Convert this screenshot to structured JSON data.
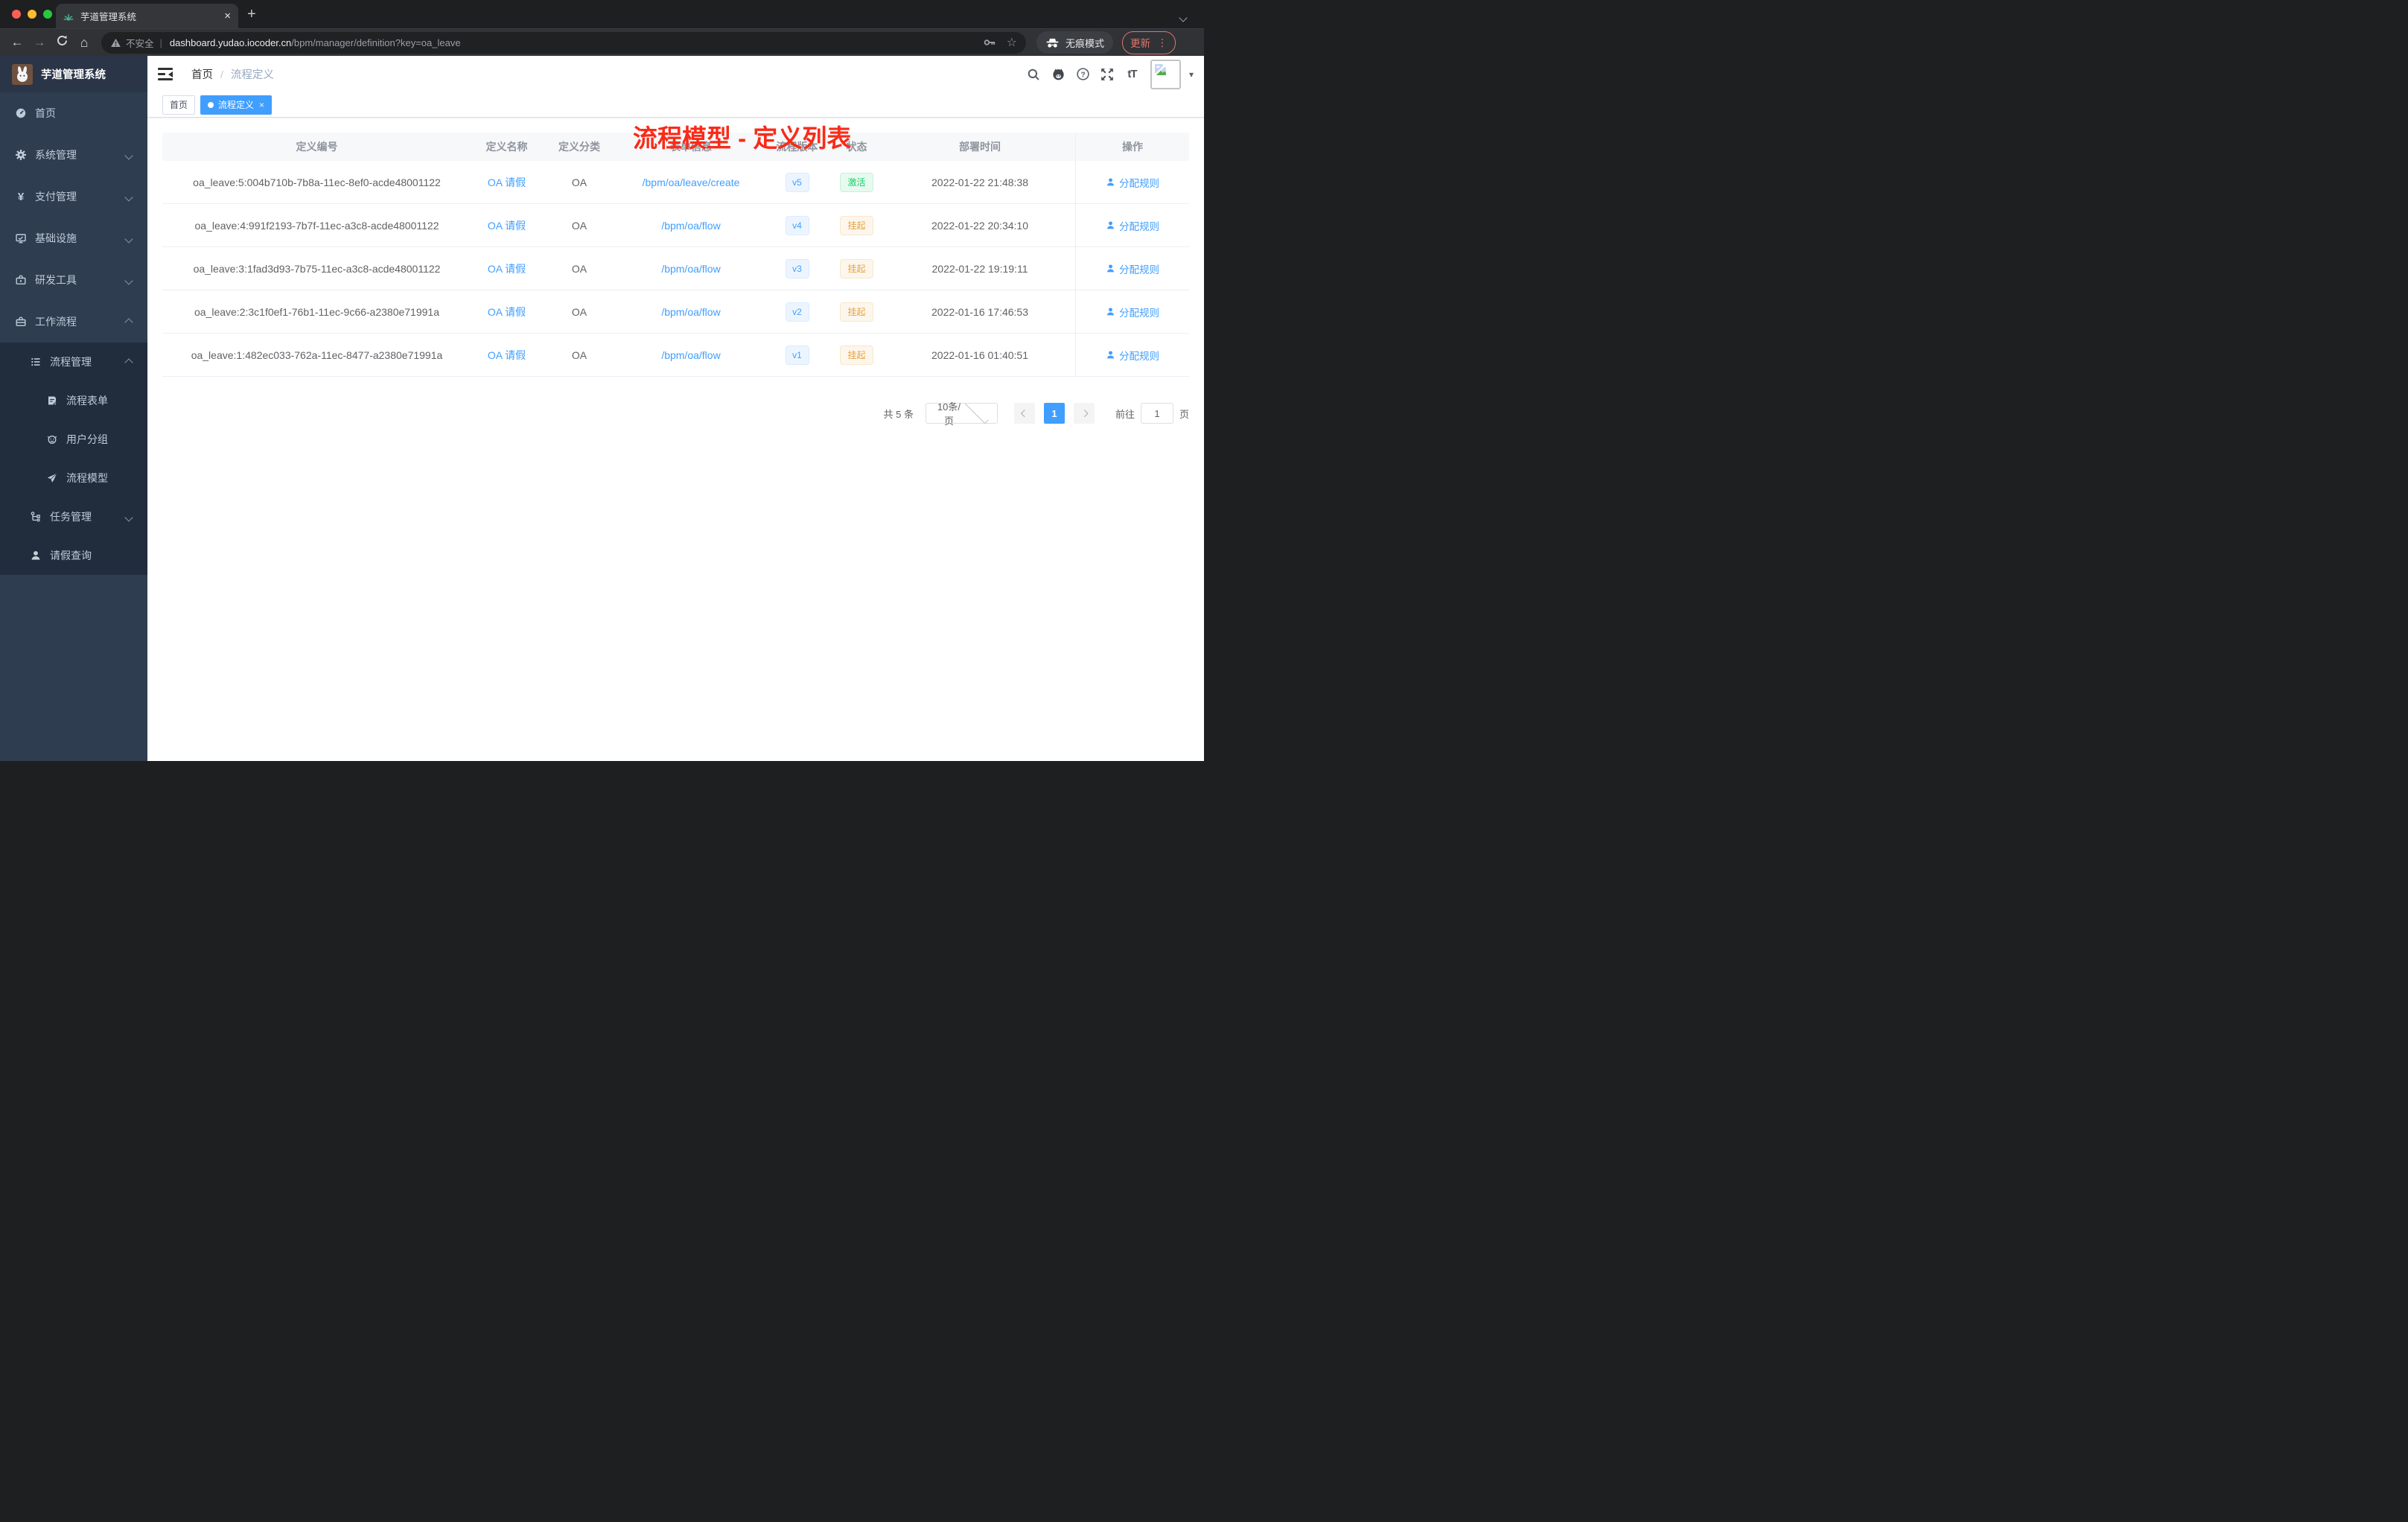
{
  "browser": {
    "tab_title": "芋道管理系统",
    "security_label": "不安全",
    "url_host": "dashboard.yudao.iocoder.cn",
    "url_path": "/bpm/manager/definition?key=oa_leave",
    "incognito_label": "无痕模式",
    "update_label": "更新"
  },
  "icons": {
    "close": "×",
    "new_tab": "+",
    "more": "⋮",
    "star": "☆",
    "caret_down": "▾",
    "back": "←",
    "forward": "→",
    "home": "⌂",
    "font_size": "tT",
    "yen": "¥",
    "divider": "|"
  },
  "annotation": {
    "text": "流程模型 - 定义列表",
    "color": "#f92b19"
  },
  "sidebar": {
    "logo_title": "芋道管理系统",
    "items": [
      {
        "label": "首页"
      },
      {
        "label": "系统管理"
      },
      {
        "label": "支付管理"
      },
      {
        "label": "基础设施"
      },
      {
        "label": "研发工具"
      },
      {
        "label": "工作流程"
      },
      {
        "label": "流程管理"
      },
      {
        "label": "流程表单"
      },
      {
        "label": "用户分组"
      },
      {
        "label": "流程模型"
      },
      {
        "label": "任务管理"
      },
      {
        "label": "请假查询"
      }
    ]
  },
  "breadcrumb": {
    "home": "首页",
    "separator": "/",
    "current": "流程定义"
  },
  "tags": [
    {
      "label": "首页"
    },
    {
      "label": "流程定义"
    }
  ],
  "table": {
    "columns": [
      "定义编号",
      "定义名称",
      "定义分类",
      "表单信息",
      "流程版本",
      "状态",
      "部署时间",
      "操作"
    ],
    "rows": [
      {
        "id": "oa_leave:5:004b710b-7b8a-11ec-8ef0-acde48001122",
        "name": "OA 请假",
        "category": "OA",
        "form": "/bpm/oa/leave/create",
        "version": "v5",
        "status": "激活",
        "deploy_time": "2022-01-22 21:48:38",
        "action": "分配规则"
      },
      {
        "id": "oa_leave:4:991f2193-7b7f-11ec-a3c8-acde48001122",
        "name": "OA 请假",
        "category": "OA",
        "form": "/bpm/oa/flow",
        "version": "v4",
        "status": "挂起",
        "deploy_time": "2022-01-22 20:34:10",
        "action": "分配规则"
      },
      {
        "id": "oa_leave:3:1fad3d93-7b75-11ec-a3c8-acde48001122",
        "name": "OA 请假",
        "category": "OA",
        "form": "/bpm/oa/flow",
        "version": "v3",
        "status": "挂起",
        "deploy_time": "2022-01-22 19:19:11",
        "action": "分配规则"
      },
      {
        "id": "oa_leave:2:3c1f0ef1-76b1-11ec-9c66-a2380e71991a",
        "name": "OA 请假",
        "category": "OA",
        "form": "/bpm/oa/flow",
        "version": "v2",
        "status": "挂起",
        "deploy_time": "2022-01-16 17:46:53",
        "action": "分配规则"
      },
      {
        "id": "oa_leave:1:482ec033-762a-11ec-8477-a2380e71991a",
        "name": "OA 请假",
        "category": "OA",
        "form": "/bpm/oa/flow",
        "version": "v1",
        "status": "挂起",
        "deploy_time": "2022-01-16 01:40:51",
        "action": "分配规则"
      }
    ]
  },
  "pagination": {
    "total": "共 5 条",
    "page_size": "10条/页",
    "page": "1",
    "goto_label": "前往",
    "goto_value": "1",
    "page_unit": "页"
  },
  "colors": {
    "primary": "#409eff",
    "success": "#13ce66",
    "warning": "#e6a23c",
    "sidebar_bg": "#2f3d50",
    "submenu_bg": "#212d3d",
    "annotation_red": "#f92b19",
    "update_red": "#e0756c"
  }
}
